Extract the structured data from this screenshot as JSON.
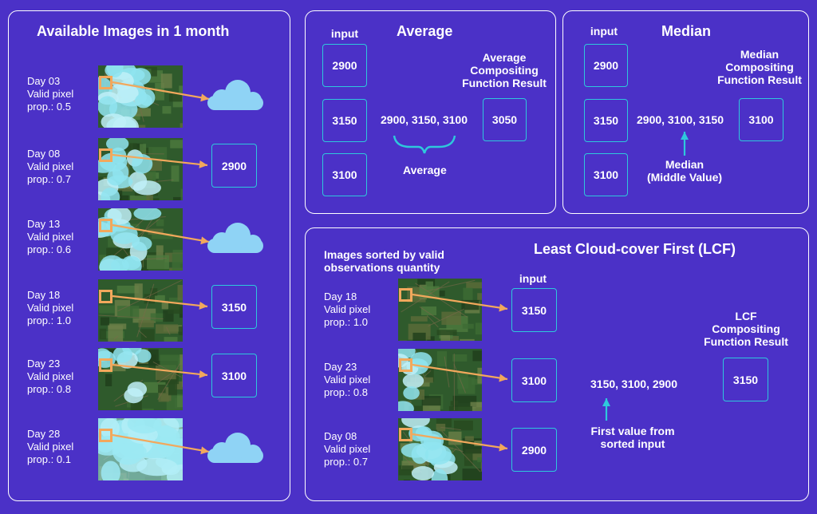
{
  "colors": {
    "background": "#4b31c7",
    "panel_border": "#ffffff",
    "box_border": "#2ec8dc",
    "arrow": "#f2a85c",
    "cloud": "#8fd3f5",
    "accent_teal": "#2ec8dc"
  },
  "left": {
    "title": "Available Images in 1 month",
    "days": [
      {
        "day": "Day 03",
        "valid": "Valid pixel",
        "prop": "prop.: 0.5",
        "result": "",
        "cloud": true
      },
      {
        "day": "Day 08",
        "valid": "Valid pixel",
        "prop": "prop.: 0.7",
        "result": "2900",
        "cloud": false
      },
      {
        "day": "Day 13",
        "valid": "Valid pixel",
        "prop": "prop.: 0.6",
        "result": "",
        "cloud": true
      },
      {
        "day": "Day 18",
        "valid": "Valid pixel",
        "prop": "prop.: 1.0",
        "result": "3150",
        "cloud": false
      },
      {
        "day": "Day 23",
        "valid": "Valid pixel",
        "prop": "prop.: 0.8",
        "result": "3100",
        "cloud": false
      },
      {
        "day": "Day 28",
        "valid": "Valid pixel",
        "prop": "prop.: 0.1",
        "result": "",
        "cloud": true
      }
    ]
  },
  "average": {
    "input_label": "input",
    "title": "Average",
    "inputs": [
      "2900",
      "3150",
      "3100"
    ],
    "list": "2900, 3150, 3100",
    "brace_label": "Average",
    "result_label": "Average\nCompositing\nFunction Result",
    "result": "3050"
  },
  "median": {
    "input_label": "input",
    "title": "Median",
    "inputs": [
      "2900",
      "3150",
      "3100"
    ],
    "list": "2900, 3100, 3150",
    "arrow_label": "Median\n(Middle Value)",
    "result_label": "Median\nCompositing\nFunction Result",
    "result": "3100"
  },
  "lcf": {
    "title": "Least Cloud-cover First (LCF)",
    "sorted_label": "Images sorted by valid\nobservations quantity",
    "input_label": "input",
    "days": [
      {
        "day": "Day 18",
        "valid": "Valid pixel",
        "prop": "prop.: 1.0",
        "value": "3150"
      },
      {
        "day": "Day 23",
        "valid": "Valid pixel",
        "prop": "prop.: 0.8",
        "value": "3100"
      },
      {
        "day": "Day 08",
        "valid": "Valid pixel",
        "prop": "prop.: 0.7",
        "value": "2900"
      }
    ],
    "list": "3150, 3100, 2900",
    "arrow_label": "First value from\nsorted input",
    "result_label": "LCF\nCompositing\nFunction Result",
    "result": "3150"
  }
}
